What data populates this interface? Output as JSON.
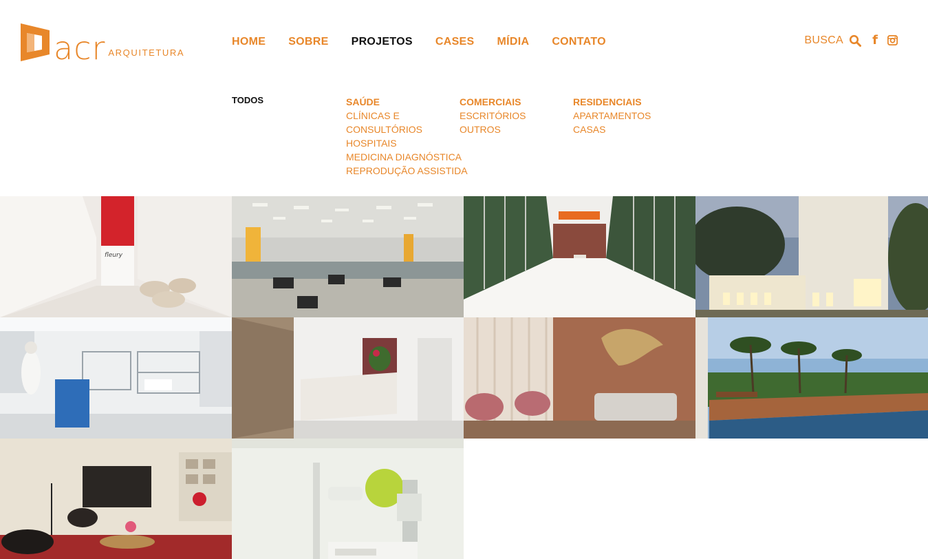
{
  "brand": {
    "word": "acr",
    "sub": "ARQUITETURA",
    "accent": "#e8872a"
  },
  "nav": {
    "items": [
      "HOME",
      "SOBRE",
      "PROJETOS",
      "CASES",
      "MÍDIA",
      "CONTATO"
    ],
    "active": "PROJETOS"
  },
  "tools": {
    "busca": "BUSCA",
    "icons": [
      "search-icon",
      "facebook-icon",
      "instagram-icon"
    ]
  },
  "submenu": {
    "todos": "TODOS",
    "columns": [
      {
        "head": "SAÚDE",
        "items": [
          "CLÍNICAS E",
          "CONSULTÓRIOS",
          "HOSPITAIS",
          "MEDICINA DIAGNÓSTICA",
          "REPRODUÇÃO ASSISTIDA"
        ]
      },
      {
        "head": "COMERCIAIS",
        "items": [
          "ESCRITÓRIOS",
          "OUTROS"
        ]
      },
      {
        "head": "RESIDENCIAIS",
        "items": [
          "APARTAMENTOS",
          "CASAS"
        ]
      }
    ]
  },
  "projects": [
    {
      "name": "project-fleury-lounge",
      "sign": "fleury"
    },
    {
      "name": "project-open-office"
    },
    {
      "name": "project-commercial-corridor"
    },
    {
      "name": "project-building-facade"
    },
    {
      "name": "project-hospital-lab"
    },
    {
      "name": "project-clinic-reception"
    },
    {
      "name": "project-living-room"
    },
    {
      "name": "project-pool-terrace"
    },
    {
      "name": "project-lounge-eames"
    },
    {
      "name": "project-xray-room"
    }
  ]
}
